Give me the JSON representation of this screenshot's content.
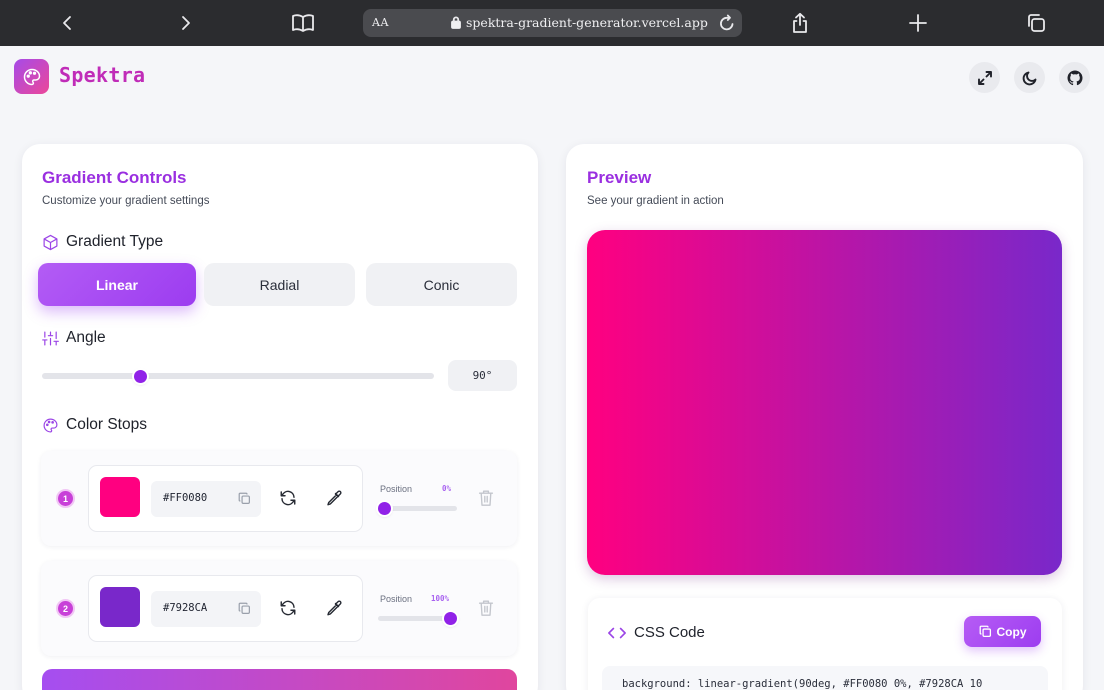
{
  "browser": {
    "text_size_label": "AA",
    "url": "spektra-gradient-generator.vercel.app"
  },
  "app": {
    "name": "Spektra"
  },
  "controls": {
    "title": "Gradient Controls",
    "subtitle": "Customize your gradient settings",
    "gradient_type": {
      "heading": "Gradient Type",
      "options": [
        "Linear",
        "Radial",
        "Conic"
      ],
      "selected": "Linear"
    },
    "angle": {
      "heading": "Angle",
      "value": 90,
      "display": "90°"
    },
    "color_stops": {
      "heading": "Color Stops",
      "position_label": "Position",
      "stops": [
        {
          "index": "1",
          "hex": "#FF0080",
          "color": "#FF0080",
          "position": 0,
          "position_text": "0%"
        },
        {
          "index": "2",
          "hex": "#7928CA",
          "color": "#7928CA",
          "position": 100,
          "position_text": "100%"
        }
      ]
    }
  },
  "preview": {
    "title": "Preview",
    "subtitle": "See your gradient in action",
    "gradient_css": "linear-gradient(90deg, #FF0080 0%, #7928CA 100%)"
  },
  "css_code": {
    "heading": "CSS Code",
    "copy_label": "Copy",
    "code": "background: linear-gradient(90deg, #FF0080 0%, #7928CA 10"
  },
  "colors": {
    "accent": "#9B3BF0",
    "brand": "#C02CB8",
    "stop_1": "#FF0080",
    "stop_2": "#7928CA"
  }
}
